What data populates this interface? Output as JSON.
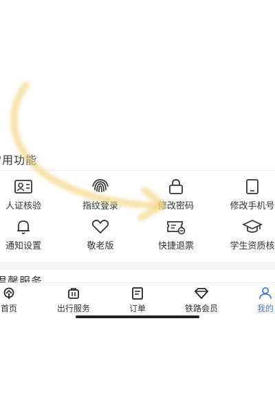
{
  "section_common": {
    "title_partial": "常用功能"
  },
  "features": [
    {
      "label": "人证核验",
      "icon": "id-card-icon"
    },
    {
      "label": "指纹登录",
      "icon": "fingerprint-icon"
    },
    {
      "label": "修改密码",
      "icon": "lock-icon"
    },
    {
      "label": "修改手机号",
      "icon": "phone-icon"
    },
    {
      "label": "通知设置",
      "icon": "bell-icon"
    },
    {
      "label": "敬老版",
      "icon": "heart-icon"
    },
    {
      "label": "快捷退票",
      "icon": "ticket-refund-icon"
    },
    {
      "label": "学生资质核",
      "icon": "graduation-cap-icon"
    }
  ],
  "section_warm": {
    "title": "温馨服务"
  },
  "tabbar": {
    "items": [
      {
        "label": "首页",
        "icon": "home-rail-icon"
      },
      {
        "label": "出行服务",
        "icon": "luggage-icon"
      },
      {
        "label": "订单",
        "icon": "order-list-icon"
      },
      {
        "label": "铁路会员",
        "icon": "diamond-icon"
      },
      {
        "label": "我的",
        "icon": "user-icon",
        "active": true
      }
    ],
    "active_color": "#3b7dd8"
  }
}
